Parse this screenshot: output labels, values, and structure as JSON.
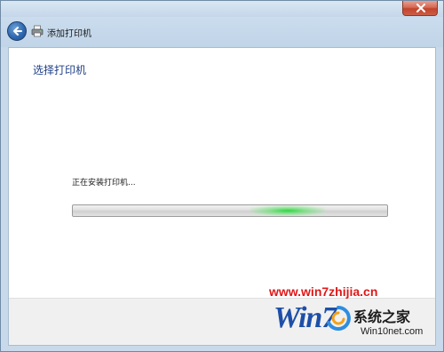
{
  "window": {
    "title": "添加打印机"
  },
  "page": {
    "heading": "选择打印机",
    "status": "正在安装打印机...",
    "progress": {
      "state": "indeterminate",
      "glow_color": "#2fd43f"
    }
  },
  "icons": {
    "back": "back-arrow-icon",
    "printer": "printer-icon",
    "close": "close-icon"
  },
  "colors": {
    "heading": "#1f3f87",
    "frame": "#c7d9ea",
    "close_button": "#c2442b",
    "watermark_url": "#e01818",
    "watermark_logo": "#1d4fa8"
  },
  "watermark": {
    "url": "www.win7zhijia.cn",
    "logo_word": "Win7",
    "brand": "系统之家",
    "domain": "Win10net.com"
  }
}
